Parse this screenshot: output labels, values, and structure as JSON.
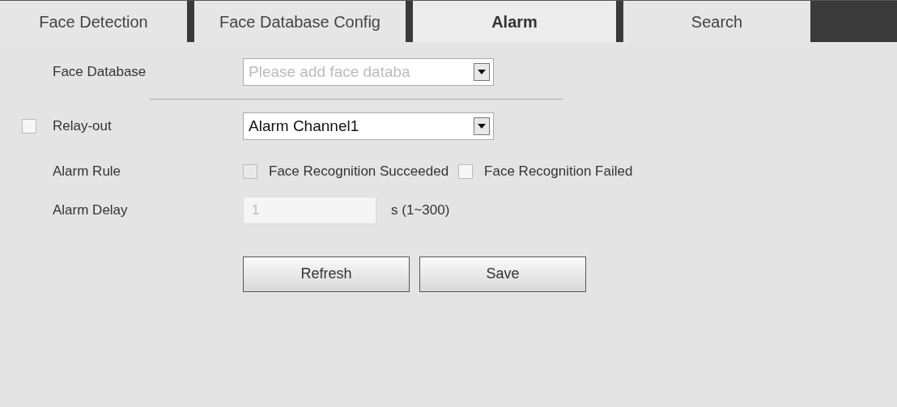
{
  "tabs": [
    {
      "label": "Face Detection",
      "selected": false
    },
    {
      "label": "Face Database Config",
      "selected": false
    },
    {
      "label": "Alarm",
      "selected": true
    },
    {
      "label": "Search",
      "selected": false
    }
  ],
  "face_database": {
    "label": "Face Database",
    "placeholder": "Please add face databa",
    "disabled": true
  },
  "relay_out": {
    "label": "Relay-out",
    "checked": false,
    "value": "Alarm Channel1"
  },
  "alarm_rule": {
    "label": "Alarm Rule",
    "options": [
      {
        "label": "Face Recognition Succeeded",
        "checked": false,
        "disabled": true
      },
      {
        "label": "Face Recognition Failed",
        "checked": false,
        "disabled": false
      }
    ]
  },
  "alarm_delay": {
    "label": "Alarm Delay",
    "value": "1",
    "disabled": true,
    "unit": "s (1~300)"
  },
  "buttons": [
    "Refresh",
    "Save"
  ]
}
